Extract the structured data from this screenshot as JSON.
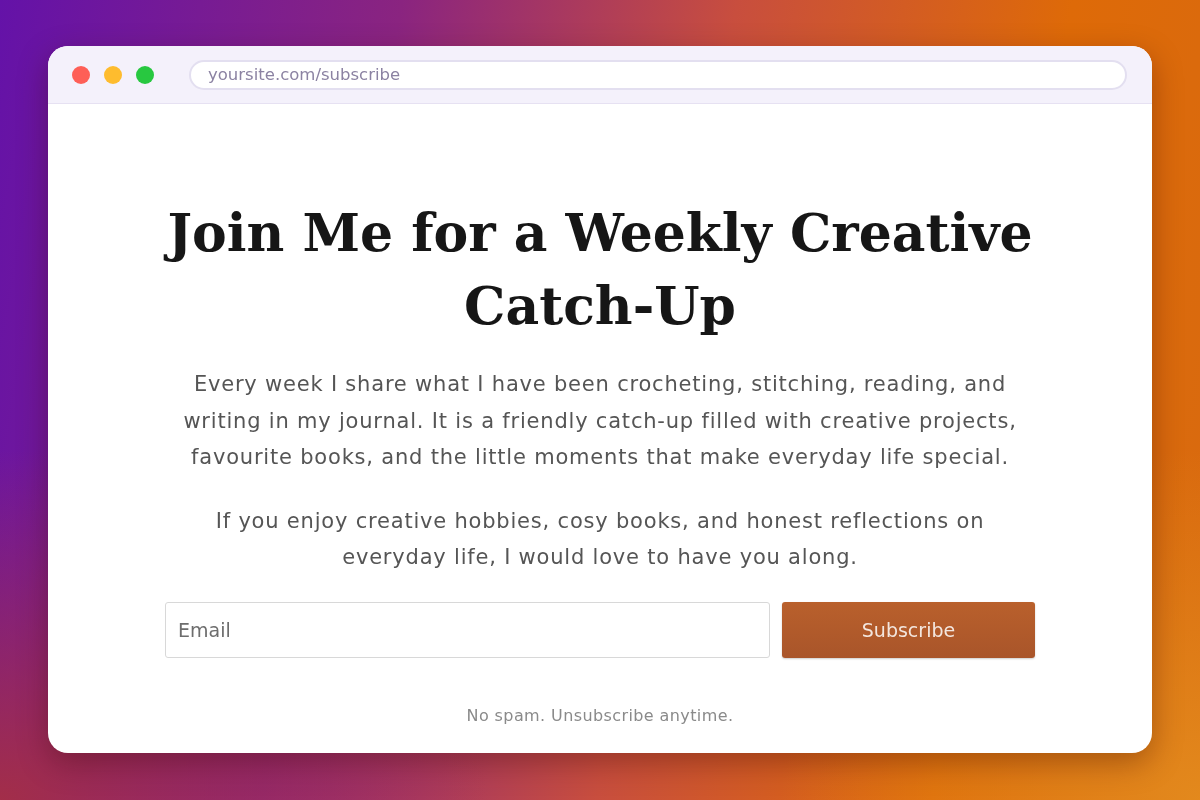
{
  "browser": {
    "url": "yoursite.com/subscribe"
  },
  "heading": "Join Me for a Weekly Creative Catch-Up",
  "paragraphs": [
    "Every week I share what I have been crocheting, stitching, reading, and writing in my journal. It is a friendly catch-up filled with creative projects, favourite books, and the little moments that make everyday life special.",
    "If you enjoy creative hobbies, cosy books, and honest reflections on everyday life, I would love to have you along."
  ],
  "form": {
    "email": {
      "placeholder": "Email"
    },
    "button": "Subscribe"
  },
  "note": "No spam. Unsubscribe anytime."
}
